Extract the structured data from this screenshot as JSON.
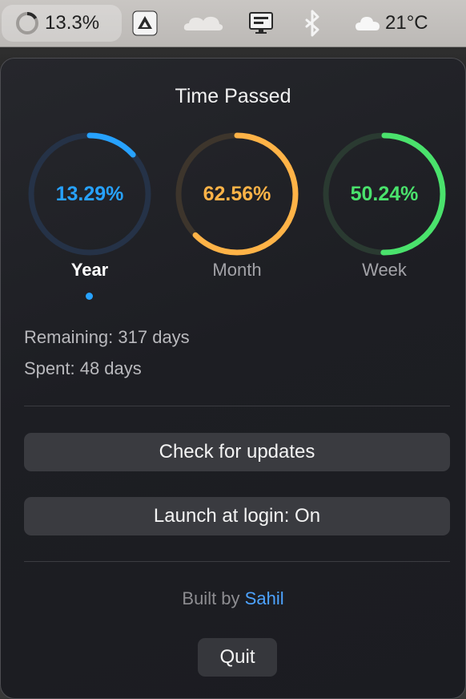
{
  "menubar": {
    "progress_text": "13.3%",
    "weather_text": "21°C",
    "icons": [
      "progress-ring-icon",
      "google-drive-icon",
      "cloudflare-icon",
      "monitor-icon",
      "bluetooth-icon",
      "cloud-icon"
    ]
  },
  "popover": {
    "title": "Time Passed",
    "rings": [
      {
        "percent_text": "13.29%",
        "label": "Year",
        "fraction": 0.1329,
        "color": "#27a2ff",
        "track": "#253247",
        "selected": true
      },
      {
        "percent_text": "62.56%",
        "label": "Month",
        "fraction": 0.6256,
        "color": "#ffb347",
        "track": "#3d352c",
        "selected": false
      },
      {
        "percent_text": "50.24%",
        "label": "Week",
        "fraction": 0.5024,
        "color": "#4ae26c",
        "track": "#2a3a31",
        "selected": false
      }
    ],
    "remaining": "Remaining: 317 days",
    "spent": "Spent: 48 days",
    "check_updates_label": "Check for updates",
    "launch_login_label": "Launch at login: On",
    "built_by_prefix": "Built by",
    "built_by_name": "Sahil",
    "quit_label": "Quit"
  }
}
